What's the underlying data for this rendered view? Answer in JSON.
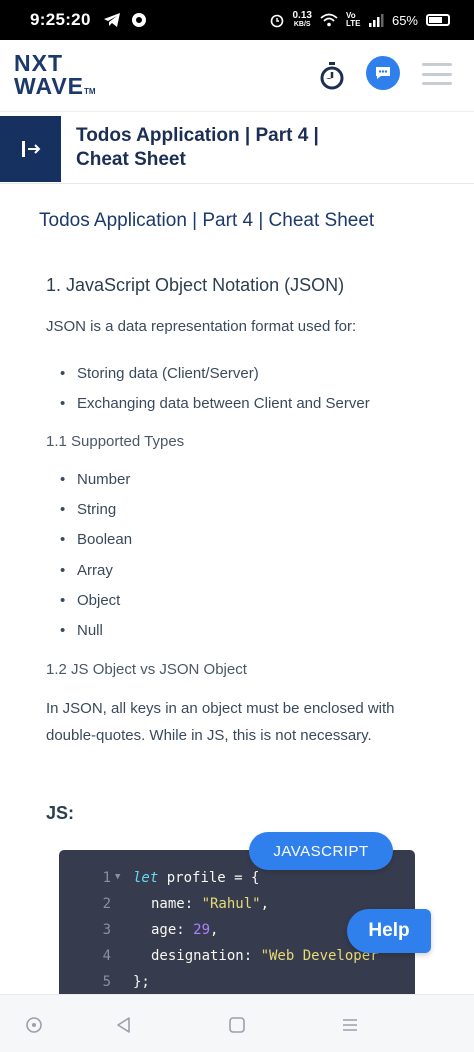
{
  "status": {
    "time": "9:25:20",
    "speed_value": "0.13",
    "speed_unit": "KB/S",
    "network": "Vo LTE",
    "battery": "65%"
  },
  "app": {
    "logo_line1": "NXT",
    "logo_line2": "WAVE",
    "logo_tm": "TM"
  },
  "header": {
    "title": "Todos Application | Part 4 | Cheat Sheet"
  },
  "content": {
    "heading": "Todos Application | Part 4 | Cheat Sheet",
    "section1_title": "1. JavaScript Object Notation (JSON)",
    "section1_intro": "JSON is a data representation format used for:",
    "uses": [
      "Storing data (Client/Server)",
      "Exchanging data between Client and Server"
    ],
    "sub1_title": "1.1 Supported Types",
    "types": [
      "Number",
      "String",
      "Boolean",
      "Array",
      "Object",
      "Null"
    ],
    "sub2_title": "1.2 JS Object vs JSON Object",
    "sub2_para": "In JSON, all keys in an object must be enclosed with double-quotes. While in JS, this is not necessary.",
    "js_label": "JS:"
  },
  "code": {
    "language": "JAVASCRIPT",
    "lines": [
      {
        "n": "1",
        "kw": "let",
        "rest": " profile = {"
      },
      {
        "n": "2",
        "key": "name: ",
        "str": "\"Rahul\"",
        "tail": ","
      },
      {
        "n": "3",
        "key": "age: ",
        "num": "29",
        "tail": ","
      },
      {
        "n": "4",
        "key": "designation: ",
        "str": "\"Web Developer",
        "tail": ""
      },
      {
        "n": "5",
        "plain": "};"
      }
    ]
  },
  "help_label": "Help",
  "colors": {
    "navy": "#16305f",
    "accent": "#2f80ed",
    "code_bg": "#363b4e"
  }
}
